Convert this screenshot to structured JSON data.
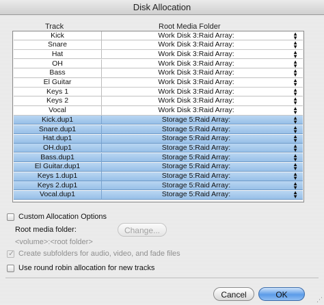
{
  "window": {
    "title": "Disk Allocation"
  },
  "table": {
    "columns": {
      "track": "Track",
      "folder": "Root Media Folder"
    },
    "rows": [
      {
        "track": "Kick",
        "folder": "Work Disk 3:Raid Array:",
        "selected": false
      },
      {
        "track": "Snare",
        "folder": "Work Disk 3:Raid Array:",
        "selected": false
      },
      {
        "track": "Hat",
        "folder": "Work Disk 3:Raid Array:",
        "selected": false
      },
      {
        "track": "OH",
        "folder": "Work Disk 3:Raid Array:",
        "selected": false
      },
      {
        "track": "Bass",
        "folder": "Work Disk 3:Raid Array:",
        "selected": false
      },
      {
        "track": "El Guitar",
        "folder": "Work Disk 3:Raid Array:",
        "selected": false
      },
      {
        "track": "Keys 1",
        "folder": "Work Disk 3:Raid Array:",
        "selected": false
      },
      {
        "track": "Keys 2",
        "folder": "Work Disk 3:Raid Array:",
        "selected": false
      },
      {
        "track": "Vocal",
        "folder": "Work Disk 3:Raid Array:",
        "selected": false
      },
      {
        "track": "Kick.dup1",
        "folder": "Storage 5:Raid Array:",
        "selected": true
      },
      {
        "track": "Snare.dup1",
        "folder": "Storage 5:Raid Array:",
        "selected": true
      },
      {
        "track": "Hat.dup1",
        "folder": "Storage 5:Raid Array:",
        "selected": true
      },
      {
        "track": "OH.dup1",
        "folder": "Storage 5:Raid Array:",
        "selected": true
      },
      {
        "track": "Bass.dup1",
        "folder": "Storage 5:Raid Array:",
        "selected": true
      },
      {
        "track": "El Guitar.dup1",
        "folder": "Storage 5:Raid Array:",
        "selected": true
      },
      {
        "track": "Keys 1.dup1",
        "folder": "Storage 5:Raid Array:",
        "selected": true
      },
      {
        "track": "Keys 2.dup1",
        "folder": "Storage 5:Raid Array:",
        "selected": true
      },
      {
        "track": "Vocal.dup1",
        "folder": "Storage 5:Raid Array:",
        "selected": true
      }
    ]
  },
  "options": {
    "custom_allocation_label": "Custom Allocation Options",
    "custom_allocation_checked": false,
    "root_media_folder_label": "Root media folder:",
    "change_button_label": "Change...",
    "path_placeholder": "<volume>:<root folder>",
    "create_subfolders_label": "Create subfolders for audio, video, and fade files",
    "create_subfolders_checked": true,
    "round_robin_label": "Use round robin allocation for new tracks",
    "round_robin_checked": false
  },
  "buttons": {
    "cancel_label": "Cancel",
    "ok_label": "OK"
  },
  "icons": {
    "popup_arrows": "updown-arrows-icon",
    "checkmark": "checkmark-icon"
  },
  "colors": {
    "selection": "#a9cbee",
    "ok_button": "#5b9be8"
  }
}
